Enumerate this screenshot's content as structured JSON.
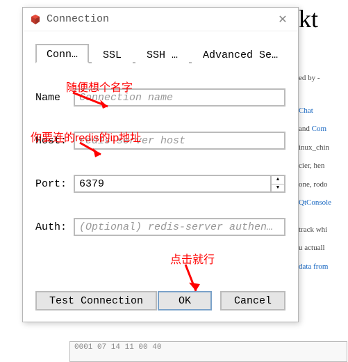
{
  "window": {
    "title": "Connection",
    "close_glyph": "✕"
  },
  "tabs": {
    "connection": "Conn…",
    "ssl": "SSL",
    "ssh": "SSH …",
    "advanced": "Advanced Se…"
  },
  "form": {
    "name_label": "Name",
    "name_placeholder": "Connection name",
    "host_label": "Host:",
    "host_placeholder": "redis-server host",
    "port_label": "Port:",
    "port_value": "6379",
    "auth_label": "Auth:",
    "auth_placeholder": "(Optional) redis-server authen…"
  },
  "buttons": {
    "test": "Test Connection",
    "ok": "OK",
    "cancel": "Cancel"
  },
  "annotations": {
    "name_hint": "随便想个名字",
    "host_hint": "你要连的redis的ip地址",
    "ok_hint": "点击就行"
  },
  "background": {
    "big_text": "kt",
    "line1": "ed by -",
    "link1": "Chat",
    "line2_a": " and ",
    "link2": "Com",
    "line3": "inux_chin",
    "line4": "cier, hen",
    "line5": "one, rodo",
    "link3": "QtConsole",
    "line6": "track whi",
    "line7": "u actuall",
    "link4": "data from",
    "bottom_text": "0001 07 14 11 00 40"
  }
}
